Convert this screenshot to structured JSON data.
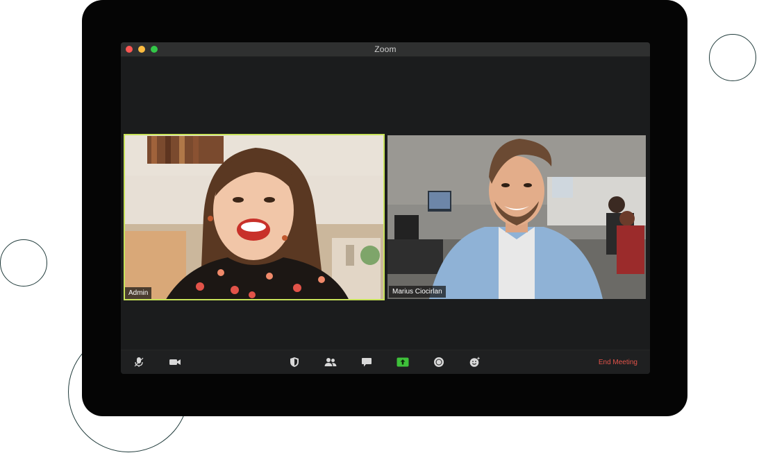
{
  "window": {
    "title": "Zoom"
  },
  "participants": [
    {
      "name": "Admin",
      "active_speaker": true
    },
    {
      "name": "Marius Ciocirlan",
      "active_speaker": false
    }
  ],
  "toolbar": {
    "buttons": [
      {
        "name": "mute",
        "icon": "microphone-muted-icon"
      },
      {
        "name": "video",
        "icon": "video-camera-icon"
      },
      {
        "name": "security",
        "icon": "shield-icon"
      },
      {
        "name": "participants",
        "icon": "participants-icon"
      },
      {
        "name": "chat",
        "icon": "chat-bubble-icon"
      },
      {
        "name": "share-screen",
        "icon": "share-screen-icon"
      },
      {
        "name": "record",
        "icon": "record-icon"
      },
      {
        "name": "reactions",
        "icon": "reactions-icon"
      }
    ],
    "end_meeting_label": "End Meeting"
  },
  "colors": {
    "active_speaker_border": "#c8e35a",
    "share_screen_green": "#3ec13a",
    "end_meeting_red": "#e25349"
  }
}
